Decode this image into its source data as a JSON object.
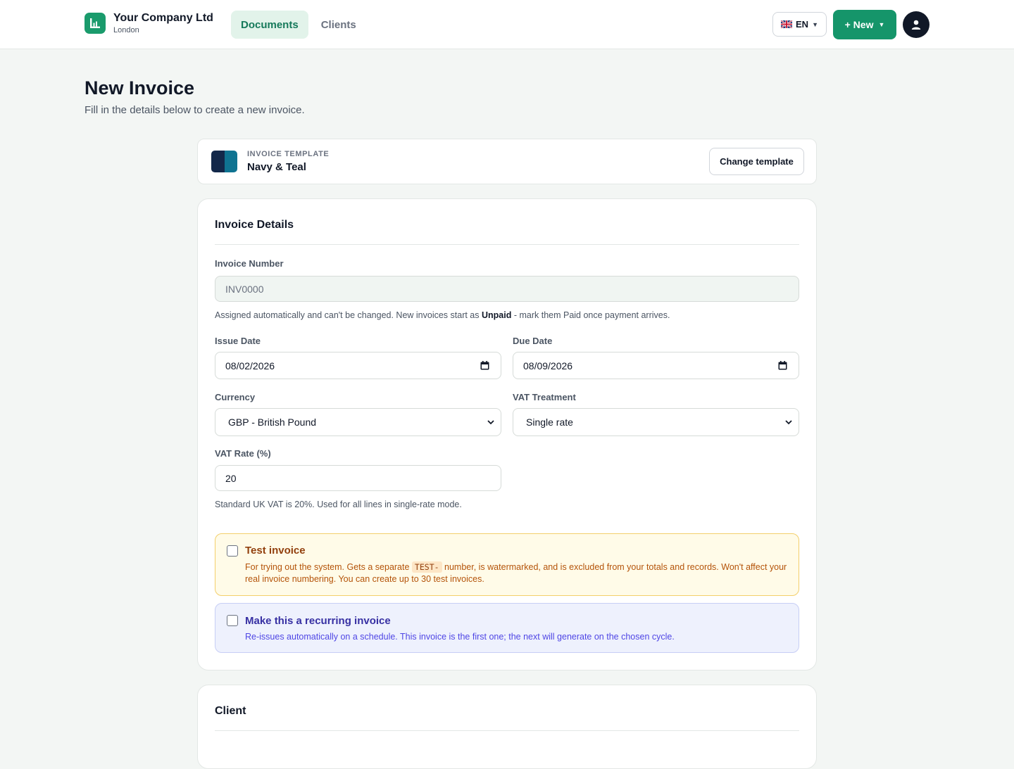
{
  "header": {
    "company_name": "Your Company Ltd",
    "company_city": "London",
    "nav": [
      {
        "label": "Documents",
        "active": true
      },
      {
        "label": "Clients",
        "active": false
      }
    ],
    "language": "EN",
    "new_button": "+ New"
  },
  "page": {
    "title": "New Invoice",
    "subtitle": "Fill in the details below to create a new invoice."
  },
  "template": {
    "label": "INVOICE TEMPLATE",
    "name": "Navy & Teal",
    "change_button": "Change template",
    "colors": [
      "#13284a",
      "#0f7391"
    ]
  },
  "details": {
    "title": "Invoice Details",
    "invoice_number": {
      "label": "Invoice Number",
      "value": "INV0000",
      "help_before": "Assigned automatically and can't be changed. New invoices start as ",
      "help_bold": "Unpaid",
      "help_after": " - mark them Paid once payment arrives."
    },
    "issue_date": {
      "label": "Issue Date",
      "value": "08/02/2026"
    },
    "due_date": {
      "label": "Due Date",
      "value": "08/09/2026"
    },
    "currency": {
      "label": "Currency",
      "value": "GBP - British Pound"
    },
    "vat_treatment": {
      "label": "VAT Treatment",
      "value": "Single rate"
    },
    "vat_rate": {
      "label": "VAT Rate (%)",
      "value": "20",
      "help": "Standard UK VAT is 20%. Used for all lines in single-rate mode."
    },
    "test_invoice": {
      "title": "Test invoice",
      "desc_before": "For trying out the system. Gets a separate ",
      "desc_code": "TEST-",
      "desc_after": " number, is watermarked, and is excluded from your totals and records. Won't affect your real invoice numbering. You can create up to 30 test invoices.",
      "checked": false
    },
    "recurring": {
      "title": "Make this a recurring invoice",
      "desc": "Re-issues automatically on a schedule. This invoice is the first one; the next will generate on the chosen cycle.",
      "checked": false
    }
  },
  "client": {
    "title": "Client"
  },
  "colors": {
    "accent": "#15956a",
    "background": "#f3f6f4"
  }
}
